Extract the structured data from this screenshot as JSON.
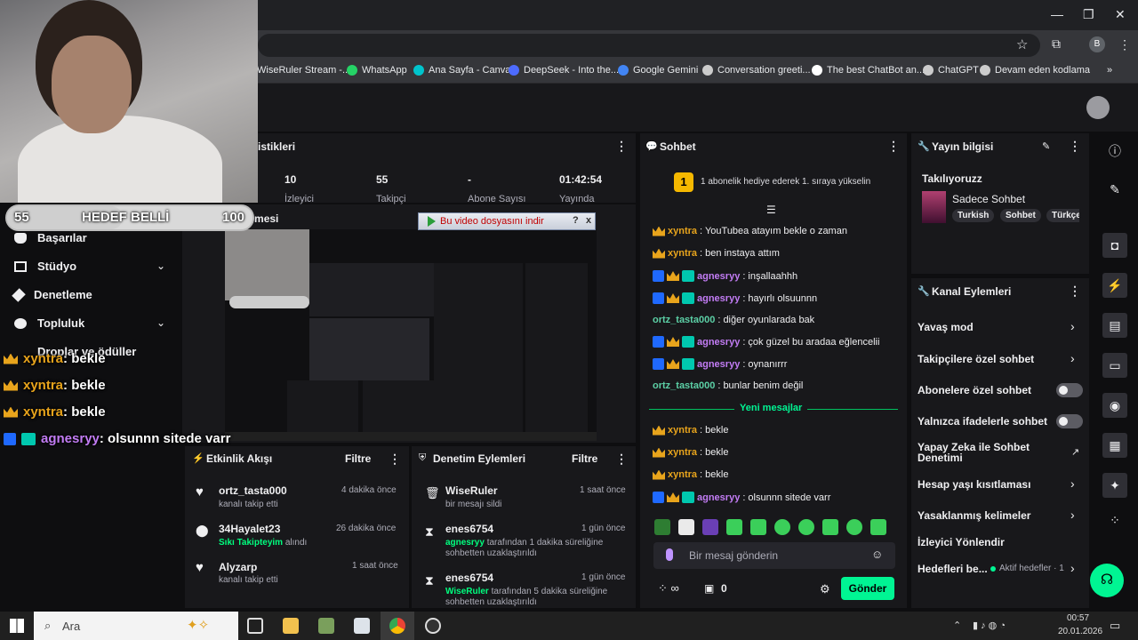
{
  "browser": {
    "bookmarks": [
      {
        "label": "WiseRuler Stream -...",
        "color": "#6441a5"
      },
      {
        "label": "WhatsApp",
        "color": "#25d366"
      },
      {
        "label": "Ana Sayfa - Canva",
        "color": "#00c4cc"
      },
      {
        "label": "DeepSeek - Into the...",
        "color": "#4d6bfe"
      },
      {
        "label": "Google Gemini",
        "color": "#4285f4"
      },
      {
        "label": "Conversation greeti...",
        "color": "#cccccc"
      },
      {
        "label": "The best ChatBot an...",
        "color": "#ffffff"
      },
      {
        "label": "ChatGPT",
        "color": "#cccccc"
      },
      {
        "label": "Devam eden kodlama",
        "color": "#cccccc"
      }
    ],
    "profile_initial": "B"
  },
  "stats": {
    "title": "istikleri",
    "items": [
      {
        "value": "10",
        "label": "İzleyici"
      },
      {
        "value": "55",
        "label": "Takipçi"
      },
      {
        "value": "-",
        "label": "Abone Sayısı"
      },
      {
        "value": "01:42:54",
        "label": "Yayında"
      }
    ]
  },
  "overlay": {
    "goal_left": "55",
    "goal_text": "HEDEF BELLİ",
    "goal_right": "100",
    "chat": [
      {
        "user": "xyntra",
        "text": " : bekle",
        "type": "x"
      },
      {
        "user": "xyntra",
        "text": " : bekle",
        "type": "x"
      },
      {
        "user": "xyntra",
        "text": " : bekle",
        "type": "x"
      },
      {
        "user": "agnesryy",
        "text": " : olsunnn sitede varr",
        "type": "a"
      }
    ]
  },
  "nav": {
    "items": [
      "Başarılar",
      "Stüdyo",
      "Denetleme",
      "Topluluk",
      "Droplar ve ödüller"
    ]
  },
  "preview": {
    "title": "Yayın izlemesi",
    "download_label": "Bu video dosyasını indir",
    "help": "?",
    "close": "x"
  },
  "chat": {
    "title": "Sohbet",
    "hype_text": "1 abonelik hediye ederek 1. sıraya yükselin",
    "hype_rank": "1",
    "messages": [
      {
        "user": "xyntra",
        "text": ": YouTubea atayım bekle o zaman",
        "type": "x"
      },
      {
        "user": "xyntra",
        "text": ": ben instaya attım",
        "type": "x"
      },
      {
        "user": "agnesryy",
        "text": ": inşallaahhh",
        "type": "a"
      },
      {
        "user": "agnesryy",
        "text": ": hayırlı olsuunnn",
        "type": "a"
      },
      {
        "user": "ortz_tasta000",
        "text": ": diğer oyunlarada bak",
        "type": "o"
      },
      {
        "user": "agnesryy",
        "text": ": çok güzel bu aradaa eğlencelii",
        "type": "a"
      },
      {
        "user": "agnesryy",
        "text": ": oynanırrr",
        "type": "a"
      },
      {
        "user": "ortz_tasta000",
        "text": ": bunlar benim değil",
        "type": "o"
      }
    ],
    "new_messages_label": "Yeni mesajlar",
    "new_messages": [
      {
        "user": "xyntra",
        "text": ": bekle",
        "type": "x"
      },
      {
        "user": "xyntra",
        "text": ": bekle",
        "type": "x"
      },
      {
        "user": "xyntra",
        "text": ": bekle",
        "type": "x"
      },
      {
        "user": "agnesryy",
        "text": ": olsunnn sitede varr",
        "type": "a"
      }
    ],
    "input_placeholder": "Bir mesaj gönderin",
    "points": "0",
    "send_label": "Gönder"
  },
  "activity": {
    "title": "Etkinlik Akışı",
    "filter": "Filtre",
    "items": [
      {
        "name": "ortz_tasta000",
        "sub": "kanalı takip etti",
        "time": "4 dakika önce"
      },
      {
        "name": "34Hayalet23",
        "sub_highlight": "Sıkı Takipteyim",
        "sub": " alındı",
        "time": "26 dakika önce"
      },
      {
        "name": "Alyzarp",
        "sub": "kanalı takip etti",
        "time": "1 saat önce"
      }
    ]
  },
  "moderation": {
    "title": "Denetim Eylemleri",
    "filter": "Filtre",
    "items": [
      {
        "name": "WiseRuler",
        "sub": "bir mesajı sildi",
        "time": "1 saat önce"
      },
      {
        "name": "enes6754",
        "sub_highlight": "agnesryy",
        "sub": " tarafından 1 dakika süreliğine sohbetten uzaklaştırıldı",
        "time": "1 gün önce"
      },
      {
        "name": "enes6754",
        "sub_highlight": "WiseRuler",
        "sub": " tarafından 5 dakika süreliğine sohbetten uzaklaştırıldı",
        "time": "1 gün önce"
      }
    ]
  },
  "stream_info": {
    "title": "Yayın bilgisi",
    "stream_title": "Takılıyoruzz",
    "category": "Sadece Sohbet",
    "tags": [
      "Turkish",
      "Sohbet",
      "Türkçe"
    ]
  },
  "channel_actions": {
    "title": "Kanal Eylemleri",
    "items": [
      {
        "label": "Yavaş mod",
        "control": "arrow"
      },
      {
        "label": "Takipçilere özel sohbet",
        "control": "arrow"
      },
      {
        "label": "Abonelere özel sohbet",
        "control": "toggle"
      },
      {
        "label": "Yalnızca ifadelerle sohbet",
        "control": "toggle"
      },
      {
        "label": "Yapay Zeka ile Sohbet Denetimi",
        "control": "external"
      },
      {
        "label": "Hesap yaşı kısıtlaması",
        "control": "arrow"
      },
      {
        "label": "Yasaklanmış kelimeler",
        "control": "arrow"
      },
      {
        "label": "İzleyici Yönlendir",
        "control": "none"
      },
      {
        "label": "Hedefleri be...",
        "control": "arrow",
        "extra": "Aktif hedefler · 1"
      }
    ]
  },
  "taskbar": {
    "search_placeholder": "Ara",
    "time": "00:57",
    "date": "20.01.2026"
  },
  "colors": {
    "accent_green": "#00f593",
    "brand": "#9147ff",
    "panel": "#18181b",
    "bg": "#0e0e10"
  }
}
